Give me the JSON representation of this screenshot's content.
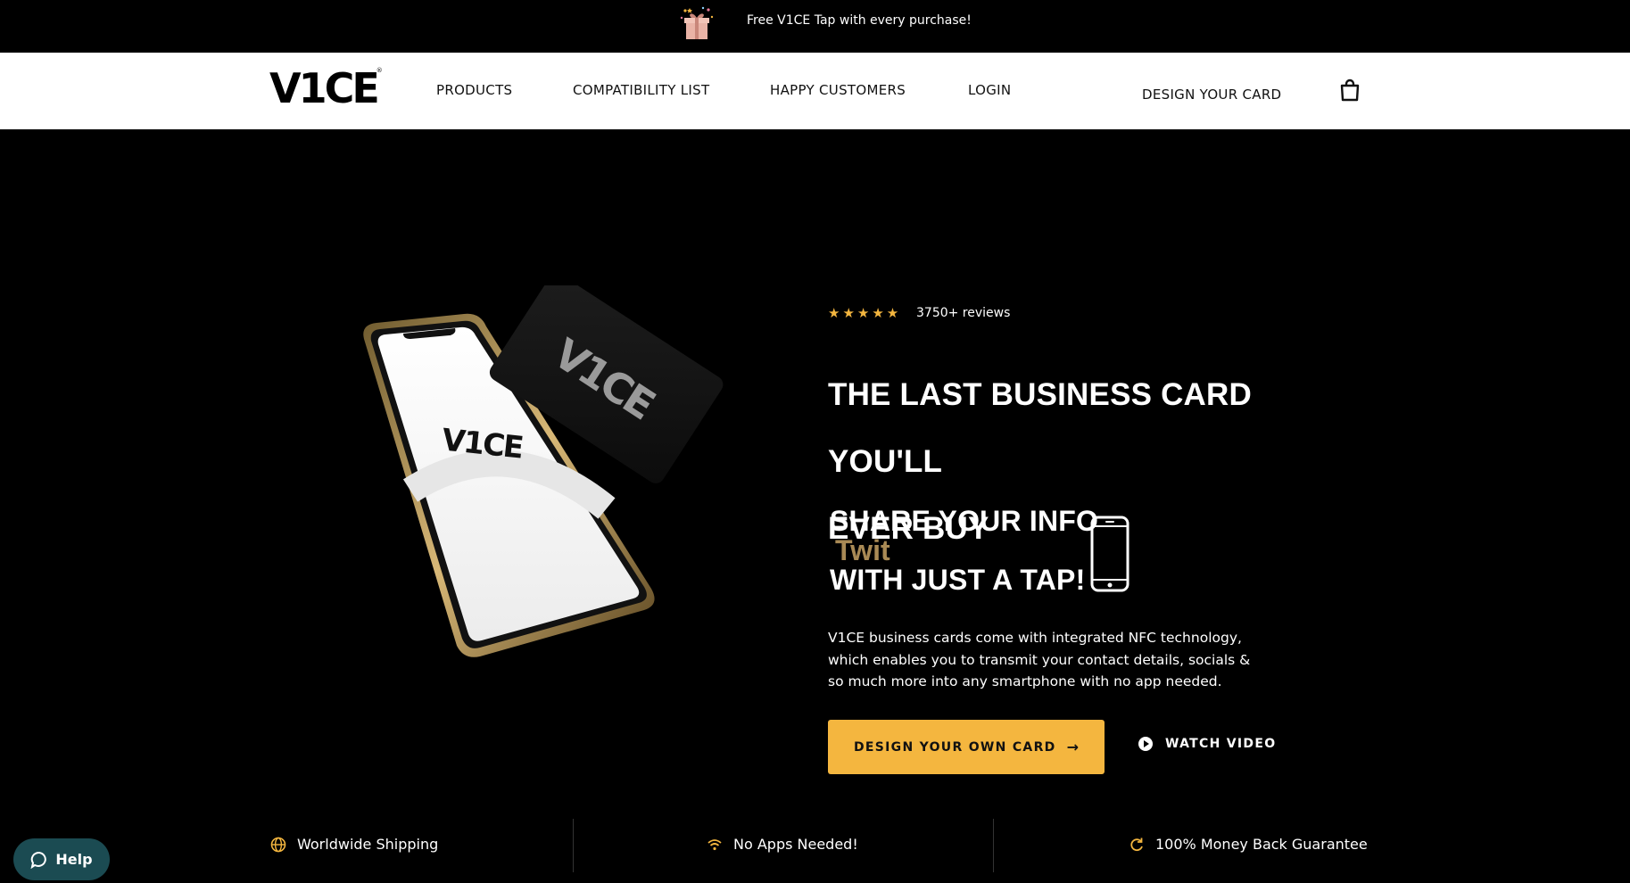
{
  "announcement": {
    "text": "Free V1CE Tap with every purchase!",
    "icon": "gift-icon"
  },
  "header": {
    "logo_text": "V1CE",
    "logo_mark": "®",
    "nav": {
      "products": "PRODUCTS",
      "compatibility": "COMPATIBILITY LIST",
      "customers": "HAPPY CUSTOMERS",
      "login": "LOGIN",
      "design": "DESIGN YOUR CARD"
    },
    "cart_icon": "shopping-bag-icon"
  },
  "hero": {
    "rating_stars": "★★★★★",
    "rating": 5,
    "reviews": "3750+ reviews",
    "headline_line1": "THE LAST BUSINESS CARD YOU'LL",
    "headline_line2": "EVER BUY",
    "share_line1": "SHARE YOUR INFO",
    "share_rotating_word": "Twit",
    "share_line2": "WITH JUST A TAP!",
    "phone_logo": "V1CE",
    "card_logo": "V1CE",
    "description": "V1CE business cards come with integrated NFC technology, which enables you to transmit your contact details, socials & so much more into any smartphone with no app needed.",
    "cta_label": "DESIGN YOUR OWN CARD",
    "cta_arrow": "→",
    "watch_label": "WATCH VIDEO"
  },
  "features": [
    {
      "label": "Worldwide Shipping",
      "icon": "globe-icon"
    },
    {
      "label": "No Apps Needed!",
      "icon": "wifi-icon"
    },
    {
      "label": "100% Money Back Guarantee",
      "icon": "refresh-icon"
    }
  ],
  "help": {
    "label": "Help",
    "icon": "chat-bubble-icon"
  },
  "colors": {
    "accent": "#f4b63f",
    "gold_text": "#a98a55",
    "background": "#000000",
    "header_bg": "#ffffff",
    "help_bg": "#1b4b52"
  }
}
